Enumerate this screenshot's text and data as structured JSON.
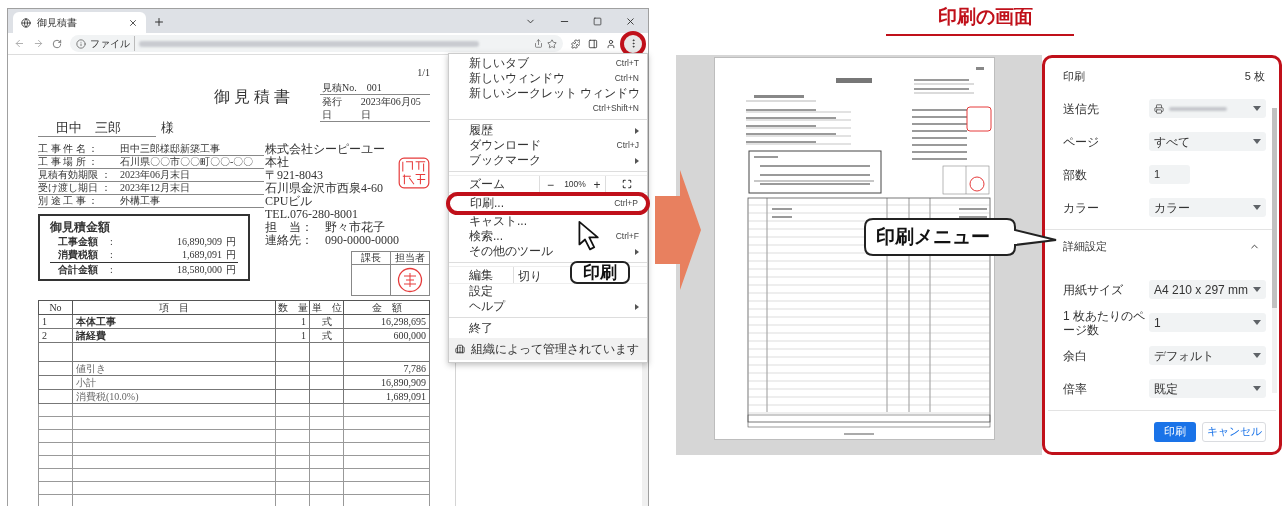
{
  "browser": {
    "tab": {
      "title": "御見積書"
    },
    "address": {
      "scheme_label": "ファイル"
    },
    "menu_button": {
      "highlighted": true
    }
  },
  "document": {
    "page_number": "1/1",
    "title": "御見積書",
    "meta": [
      {
        "label": "見積No.",
        "value": "001"
      },
      {
        "label": "発行日",
        "value": "2023年06月05日"
      }
    ],
    "recipient": {
      "name": "田中　三郎",
      "honorific": "様"
    },
    "details": [
      {
        "label": "工 事 件 名 ：",
        "value": "田中三郎様邸新築工事"
      },
      {
        "label": "工 事 場 所 ：",
        "value": "石川県〇〇市〇〇町〇〇-〇〇"
      },
      {
        "label": "見積有効期限 ：",
        "value": "2023年06月末日"
      },
      {
        "label": "受け渡し期日 ：",
        "value": "2023年12月末日"
      },
      {
        "label": "別 途 工 事 ：",
        "value": "外構工事"
      }
    ],
    "estimate": {
      "title": "御見積金額",
      "rows": [
        {
          "label": "工事金額",
          "colon": ":",
          "amount": "16,890,909",
          "unit": "円",
          "total": false
        },
        {
          "label": "消費税額",
          "colon": ":",
          "amount": "1,689,091",
          "unit": "円",
          "total": false
        },
        {
          "label": "合計金額",
          "colon": ":",
          "amount": "18,580,000",
          "unit": "円",
          "total": true
        }
      ]
    },
    "company": [
      "株式会社シーピーユー",
      "本社",
      "〒921-8043",
      "石川県金沢市西泉4-60",
      "CPUビル",
      "TEL.076-280-8001",
      "担　当：　野々市花子",
      "連絡先：　090-0000-0000"
    ],
    "approvals": [
      {
        "label": "課長",
        "stamped": false
      },
      {
        "label": "担当者",
        "stamped": true
      }
    ],
    "table": {
      "columns": [
        "No",
        "項　目",
        "数　量",
        "単　位",
        "金　額"
      ],
      "rows": [
        {
          "kind": "item",
          "no": "1",
          "item": "本体工事",
          "qty": "1",
          "unit": "式",
          "amount": "16,298,695"
        },
        {
          "kind": "item",
          "no": "2",
          "item": "諸経費",
          "qty": "1",
          "unit": "式",
          "amount": "600,000"
        },
        {
          "kind": "blank"
        },
        {
          "kind": "note",
          "item": "値引き",
          "amount": "7,786"
        },
        {
          "kind": "note",
          "item": "小計",
          "amount": "16,890,909"
        },
        {
          "kind": "note",
          "item": "消費税(10.0%)",
          "amount": "1,689,091"
        }
      ]
    }
  },
  "browser_menu": {
    "items": [
      {
        "kind": "item",
        "label": "新しいタブ",
        "shortcut": "Ctrl+T",
        "submenu": false,
        "highlighted": false
      },
      {
        "kind": "item",
        "label": "新しいウィンドウ",
        "shortcut": "Ctrl+N",
        "submenu": false,
        "highlighted": false
      },
      {
        "kind": "item",
        "label": "新しいシークレット ウィンドウ",
        "shortcut": "Ctrl+Shift+N",
        "submenu": false,
        "highlighted": false
      },
      {
        "kind": "separator"
      },
      {
        "kind": "item",
        "label": "履歴",
        "submenu": true,
        "highlighted": false
      },
      {
        "kind": "item",
        "label": "ダウンロード",
        "shortcut": "Ctrl+J",
        "submenu": false,
        "highlighted": false
      },
      {
        "kind": "item",
        "label": "ブックマーク",
        "submenu": true,
        "highlighted": false
      },
      {
        "kind": "separator"
      },
      {
        "kind": "zoom",
        "label": "ズーム",
        "minus": "−",
        "value": "100%",
        "plus": "+"
      },
      {
        "kind": "item",
        "label": "印刷...",
        "shortcut": "Ctrl+P",
        "submenu": false,
        "highlighted": true
      },
      {
        "kind": "item",
        "label": "キャスト...",
        "submenu": false,
        "highlighted": false
      },
      {
        "kind": "item",
        "label": "検索...",
        "shortcut": "Ctrl+F",
        "submenu": false,
        "highlighted": false
      },
      {
        "kind": "item",
        "label": "その他のツール",
        "submenu": true,
        "highlighted": false
      },
      {
        "kind": "separator"
      },
      {
        "kind": "edit",
        "label": "編集",
        "actions": [
          "切り"
        ]
      },
      {
        "kind": "item",
        "label": "設定",
        "submenu": false,
        "highlighted": false
      },
      {
        "kind": "item",
        "label": "ヘルプ",
        "submenu": true,
        "highlighted": false
      },
      {
        "kind": "separator"
      },
      {
        "kind": "item",
        "label": "終了",
        "submenu": false,
        "highlighted": false
      },
      {
        "kind": "managed",
        "label": "組織によって管理されています"
      }
    ]
  },
  "menu_callout": "印刷",
  "section_title": "印刷の画面",
  "print_callout": "印刷メニュー",
  "print_dialog": {
    "title": "印刷",
    "sheet_count": "5 枚",
    "settings": [
      {
        "kind": "printer",
        "label": "送信先"
      },
      {
        "kind": "select",
        "label": "ページ",
        "value": "すべて"
      },
      {
        "kind": "input",
        "label": "部数",
        "value": "1"
      },
      {
        "kind": "select",
        "label": "カラー",
        "value": "カラー"
      }
    ],
    "advanced": {
      "label": "詳細設定",
      "expanded": true,
      "settings": [
        {
          "kind": "select",
          "label": "用紙サイズ",
          "value": "A4 210 x 297 mm"
        },
        {
          "kind": "select",
          "label": "1 枚あたりのページ数",
          "value": "1"
        },
        {
          "kind": "select",
          "label": "余白",
          "value": "デフォルト"
        },
        {
          "kind": "select",
          "label": "倍率",
          "value": "既定"
        }
      ]
    },
    "buttons": [
      {
        "label": "印刷",
        "primary": true
      },
      {
        "label": "キャンセル",
        "primary": false
      }
    ]
  }
}
